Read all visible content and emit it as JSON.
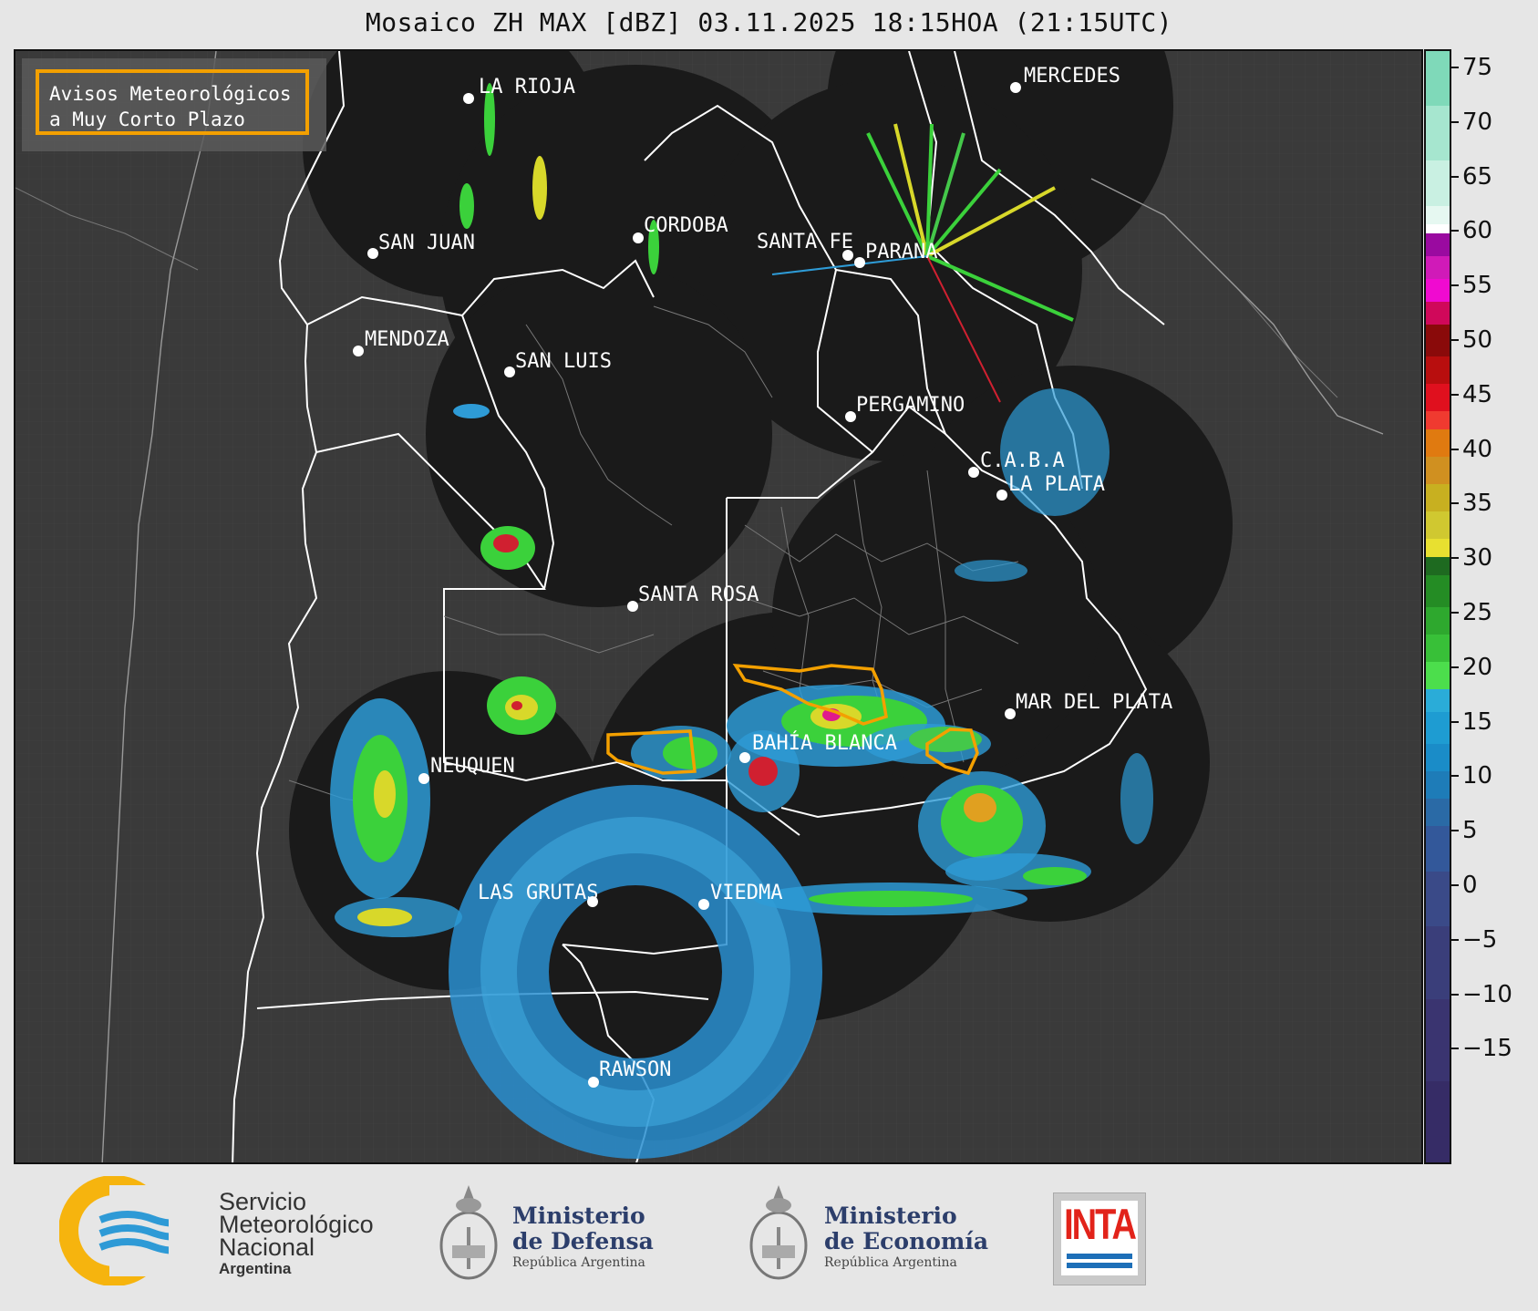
{
  "title": "Mosaico ZH MAX [dBZ] 03.11.2025 18:15HOA (21:15UTC)",
  "legend": {
    "line1": "Avisos Meteorológicos",
    "line2": "a Muy Corto Plazo",
    "border_color": "#f3a000"
  },
  "colorbar": {
    "ticks": [
      "75",
      "70",
      "65",
      "60",
      "55",
      "50",
      "45",
      "40",
      "35",
      "30",
      "25",
      "20",
      "15",
      "10",
      "5",
      "0",
      "−5",
      "−10",
      "−15"
    ]
  },
  "cities": [
    {
      "name": "LA RIOJA"
    },
    {
      "name": "MERCEDES"
    },
    {
      "name": "SAN JUAN"
    },
    {
      "name": "CORDOBA"
    },
    {
      "name": "SANTA FE"
    },
    {
      "name": "PARANA"
    },
    {
      "name": "MENDOZA"
    },
    {
      "name": "SAN LUIS"
    },
    {
      "name": "PERGAMINO"
    },
    {
      "name": "C.A.B.A"
    },
    {
      "name": "LA PLATA"
    },
    {
      "name": "SANTA ROSA"
    },
    {
      "name": "MAR DEL PLATA"
    },
    {
      "name": "BAHÍA BLANCA"
    },
    {
      "name": "NEUQUEN"
    },
    {
      "name": "LAS GRUTAS"
    },
    {
      "name": "VIEDMA"
    },
    {
      "name": "RAWSON"
    }
  ],
  "footer": {
    "smn_line1": "Servicio",
    "smn_line2": "Meteorológico",
    "smn_line3": "Nacional",
    "smn_line4": "Argentina",
    "defensa_line1": "Ministerio",
    "defensa_line2": "de Defensa",
    "defensa_sub": "República Argentina",
    "economia_line1": "Ministerio",
    "economia_line2": "de Economía",
    "economia_sub": "República Argentina",
    "inta": "INTA"
  },
  "colors": {
    "radar_disc": "#1a1a1a",
    "map_bg": "#3a3a3a",
    "boundary": "#ffffff",
    "warning_polygon": "#f3a000"
  }
}
